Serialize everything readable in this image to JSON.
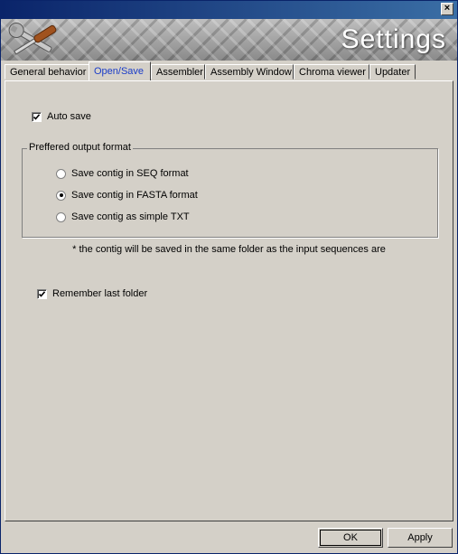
{
  "window": {
    "title": "",
    "close_glyph": "×",
    "banner_title": "Settings",
    "banner_icon": "tools-icon"
  },
  "tabs": [
    {
      "label": "General behavior",
      "active": false
    },
    {
      "label": "Open/Save",
      "active": true
    },
    {
      "label": "Assembler",
      "active": false
    },
    {
      "label": "Assembly Window",
      "active": false
    },
    {
      "label": "Chroma viewer",
      "active": false
    },
    {
      "label": "Updater",
      "active": false
    }
  ],
  "open_save": {
    "auto_save": {
      "label": "Auto save",
      "checked": true
    },
    "output_format": {
      "legend": "Preffered output format",
      "options": [
        {
          "label": "Save contig in SEQ format",
          "selected": false
        },
        {
          "label": "Save contig in FASTA format",
          "selected": true
        },
        {
          "label": "Save contig as simple TXT",
          "selected": false
        }
      ]
    },
    "note": "* the contig will be saved in the same folder as the input sequences are",
    "remember_folder": {
      "label": "Remember last folder",
      "checked": true
    }
  },
  "buttons": {
    "ok": "OK",
    "apply": "Apply"
  },
  "colors": {
    "dialog_bg": "#d4d0c8",
    "active_tab_text": "#1a3cc8",
    "titlebar": "#0a246a"
  }
}
